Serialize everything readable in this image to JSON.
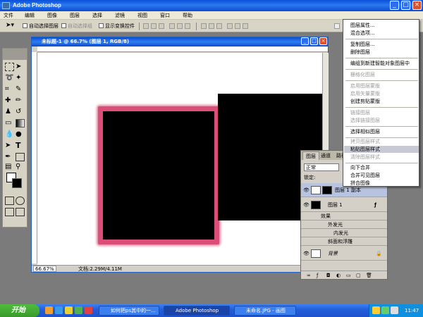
{
  "window": {
    "title": "Adobe Photoshop"
  },
  "menubar": [
    "文件",
    "编辑",
    "图像",
    "图层",
    "选择",
    "滤镜",
    "视图",
    "窗口",
    "帮助"
  ],
  "options": {
    "auto_select": "自动选择图层",
    "auto_select_group": "自动选择组",
    "show_bounds": "显示变换控件"
  },
  "document": {
    "title": "未标题-1 @ 66.7% (图层 1, RGB/8)",
    "zoom": "66.67%",
    "doc_info": "文档:2.29M/4.11M"
  },
  "layers_panel": {
    "tabs": [
      "图层",
      "通道",
      "路径"
    ],
    "blend_mode": "正常",
    "lock_label": "锁定:",
    "layers": [
      {
        "name": "图层 1 副本"
      },
      {
        "name": "图层 1"
      },
      {
        "name": "效果",
        "kind": "effects"
      },
      {
        "name": "外发光",
        "kind": "effect"
      },
      {
        "name": "内发光",
        "kind": "effect"
      },
      {
        "name": "斜面和浮雕",
        "kind": "effect"
      },
      {
        "name": "背景"
      }
    ]
  },
  "context_menu": {
    "highlighted": "粘贴图层样式",
    "items": [
      {
        "label": "图层属性...",
        "disabled": false
      },
      {
        "label": "混合选项...",
        "disabled": false
      },
      {
        "label": "复制图层...",
        "disabled": false
      },
      {
        "label": "删除图层",
        "disabled": false
      },
      {
        "label": "编组到新建智能对象图层中",
        "disabled": false
      },
      {
        "label": "栅格化图层",
        "disabled": true
      },
      {
        "label": "启用图层蒙版",
        "disabled": true
      },
      {
        "label": "启用矢量蒙版",
        "disabled": true
      },
      {
        "label": "创建剪贴蒙版",
        "disabled": false
      },
      {
        "label": "链接图层",
        "disabled": true
      },
      {
        "label": "选择链接图层",
        "disabled": true
      },
      {
        "label": "选择相似图层",
        "disabled": false
      },
      {
        "label": "拷贝图层样式",
        "disabled": true
      },
      {
        "label": "粘贴图层样式",
        "disabled": false
      },
      {
        "label": "清除图层样式",
        "disabled": true
      },
      {
        "label": "向下合并",
        "disabled": false
      },
      {
        "label": "合并可见图层",
        "disabled": false
      },
      {
        "label": "拼合图像",
        "disabled": false
      }
    ]
  },
  "taskbar": {
    "start": "开始",
    "buttons": [
      "如何把ps其中的一...",
      "Adobe Photoshop",
      "未命名.JPG - 画图"
    ],
    "clock": "11:47"
  },
  "colors": {
    "pink_glow": "#d94f78",
    "xp_blue": "#245edb",
    "start_green": "#3a9a2c"
  }
}
